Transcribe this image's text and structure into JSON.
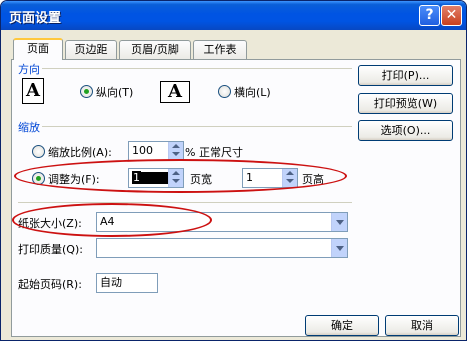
{
  "window": {
    "title": "页面设置",
    "help_glyph": "?",
    "close_glyph": "✕"
  },
  "tabs": [
    "页面",
    "页边距",
    "页眉/页脚",
    "工作表"
  ],
  "orientation": {
    "section_label": "方向",
    "portrait_label": "纵向(T)",
    "landscape_label": "横向(L)",
    "icon_letter": "A",
    "selected": "portrait"
  },
  "scaling": {
    "section_label": "缩放",
    "adjust_to_label": "缩放比例(A):",
    "adjust_to_value": "100",
    "adjust_to_suffix": "% 正常尺寸",
    "fit_to_label": "调整为(F):",
    "pages_wide_value": "1",
    "pages_wide_label": "页宽",
    "pages_tall_value": "1",
    "pages_tall_label": "页高",
    "selected": "fit_to"
  },
  "paper_size": {
    "label": "纸张大小(Z):",
    "value": "A4"
  },
  "print_quality": {
    "label": "打印质量(Q):",
    "value": ""
  },
  "first_page_number": {
    "label": "起始页码(R):",
    "value": "自动"
  },
  "side_buttons": [
    "打印(P)...",
    "打印预览(W)",
    "选项(O)..."
  ],
  "footer_buttons": {
    "ok": "确定",
    "cancel": "取消"
  },
  "annotation_color": "#cc1111"
}
